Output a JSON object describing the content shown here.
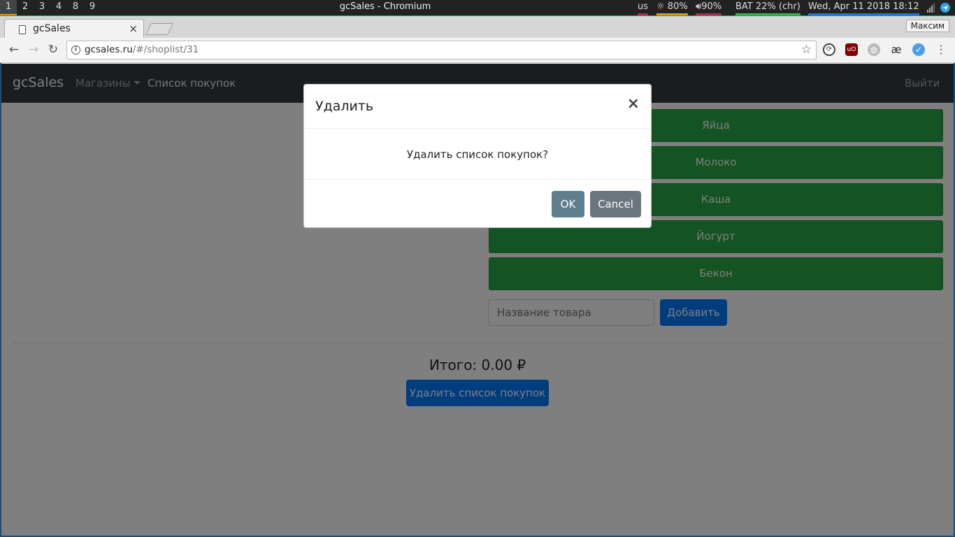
{
  "system_bar": {
    "workspaces": [
      "1",
      "2",
      "3",
      "4",
      "8",
      "9"
    ],
    "active_workspace": "1",
    "window_title": "gcSales - Chromium",
    "keyboard": "us",
    "brightness": "80%",
    "volume": "90%",
    "battery": "BAT 22% (chr)",
    "datetime": "Wed, Apr 11 2018 18:12"
  },
  "browser": {
    "tab_title": "gcSales",
    "tab_close": "×",
    "profile_name": "Максим",
    "url_host": "gcsales.ru",
    "url_path": "/#/shoplist/31"
  },
  "navbar": {
    "brand": "gcSales",
    "stores": "Магазины",
    "shopping_list": "Список покупок",
    "logout": "Выйти"
  },
  "items": [
    "Яйца",
    "Молоко",
    "Каша",
    "Йогурт",
    "Бекон"
  ],
  "add_form": {
    "placeholder": "Название товара",
    "add_label": "Добавить"
  },
  "total": "Итого: 0.00 ₽",
  "delete_list_label": "Удалить список покупок",
  "modal": {
    "title": "Удалить",
    "close": "×",
    "message": "Удалить список покупок?",
    "ok": "OK",
    "cancel": "Cancel"
  },
  "colors": {
    "item_green": "#28a745",
    "primary_blue": "#007bff",
    "navbar_dark": "#343a40"
  }
}
